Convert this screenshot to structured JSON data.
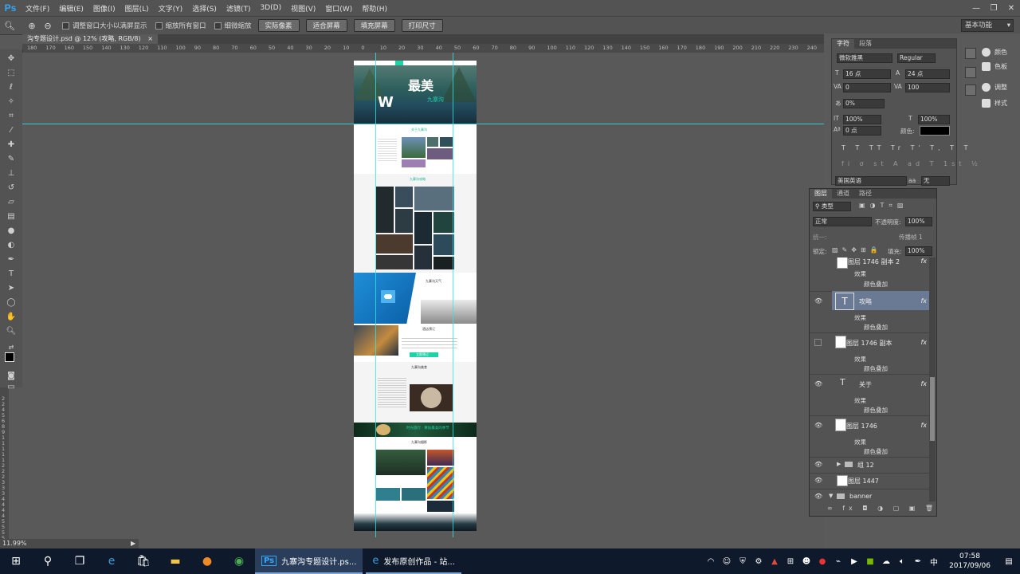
{
  "app": {
    "logo": "Ps"
  },
  "menu": {
    "items": [
      "文件(F)",
      "编辑(E)",
      "图像(I)",
      "图层(L)",
      "文字(Y)",
      "选择(S)",
      "滤镜(T)",
      "3D(D)",
      "视图(V)",
      "窗口(W)",
      "帮助(H)"
    ]
  },
  "options": {
    "resize_window": "调整窗口大小以满屏显示",
    "zoom_all": "缩放所有窗口",
    "scrubby_zoom": "细微缩放",
    "btn_actual": "实际像素",
    "btn_fit": "适合屏幕",
    "btn_fill": "填充屏幕",
    "btn_print": "打印尺寸",
    "workspace": "基本功能"
  },
  "document": {
    "tab_title": "沟专题设计.psd @ 12% (攻略, RGB/8)",
    "tab_close": "×"
  },
  "ruler": {
    "top_labels": [
      "180",
      "170",
      "160",
      "150",
      "140",
      "130",
      "120",
      "110",
      "100",
      "90",
      "80",
      "70",
      "60",
      "50",
      "40",
      "30",
      "20",
      "10",
      "0",
      "10",
      "20",
      "30",
      "40",
      "50",
      "60",
      "70",
      "80",
      "90",
      "100",
      "110",
      "120",
      "130",
      "140",
      "150",
      "160",
      "170",
      "180",
      "190",
      "200",
      "210",
      "220",
      "230",
      "240"
    ],
    "left_labels": [
      "2",
      "2",
      "4",
      "5",
      "6",
      "8",
      "9",
      "1",
      "1",
      "1",
      "1",
      "1",
      "2",
      "2",
      "2",
      "3",
      "3",
      "3",
      "4",
      "4",
      "4",
      "4",
      "5",
      "5",
      "5",
      "5"
    ]
  },
  "design": {
    "hero_text": "最美",
    "hero_sub": "九寨沟",
    "hero_letter": "W",
    "about_title": "关于九寨沟",
    "guide_title": "九寨沟攻略",
    "weather_title": "九寨沟天气",
    "hotel_title": "酒店预订",
    "food_title": "九寨沟美食",
    "banner_text": "时光旅行 · 邂逅最美的季节",
    "photo_title": "九寨沟摄影",
    "book_btn": "立即预订"
  },
  "status": {
    "zoom": "11.99%"
  },
  "character": {
    "tab_char": "字符",
    "tab_para": "段落",
    "font": "微软雅黑",
    "style": "Regular",
    "size": "16 点",
    "leading": "24 点",
    "kerning": "0",
    "tracking": "100",
    "scale_pct": "0%",
    "vscale": "100%",
    "hscale": "100%",
    "baseline": "0 点",
    "color_label": "颜色:",
    "type_styles": "T T TT Tr T' T, T T",
    "type_styles2": "fi σ st A ad T 1st ½",
    "language": "美国英语",
    "aa_label": "aa",
    "aa": "无"
  },
  "mini_panels": {
    "color": "颜色",
    "swatches": "色板",
    "adjust": "调整",
    "styles": "样式"
  },
  "layers": {
    "tabs": [
      "图层",
      "通道",
      "路径"
    ],
    "filter": "类型",
    "blend": "正常",
    "opacity_label": "不透明度:",
    "opacity": "100%",
    "lock_label": "锁定:",
    "fill_label": "填充:",
    "fill": "100%",
    "unify_label": "统一:",
    "propagate": "传播帧 1",
    "rows": [
      {
        "name": "图层 1746 副本 2",
        "kind": "image",
        "fx": "fx",
        "effects": "效果",
        "effect": "颜色叠加"
      },
      {
        "name": "攻略",
        "kind": "text",
        "fx": "fx",
        "effects": "效果",
        "effect": "颜色叠加"
      },
      {
        "name": "图层 1746 副本",
        "kind": "image",
        "fx": "fx",
        "effects": "效果",
        "effect": "颜色叠加"
      },
      {
        "name": "关于",
        "kind": "text",
        "fx": "fx",
        "effects": "效果",
        "effect": "颜色叠加"
      },
      {
        "name": "图层 1746",
        "kind": "image",
        "fx": "fx",
        "effects": "效果",
        "effect": "颜色叠加"
      },
      {
        "name": "组 12",
        "kind": "group"
      },
      {
        "name": "图层 1447",
        "kind": "image"
      },
      {
        "name": "banner",
        "kind": "group"
      }
    ],
    "bottom_icons": "∞ fx ◘ ◑ ▢ ▣ 🗑"
  },
  "taskbar": {
    "ps_app": "九寨沟专题设计.ps...",
    "ie_app": "发布原创作品 - 站...",
    "ime": "中",
    "time": "07:58",
    "date": "2017/09/06"
  }
}
